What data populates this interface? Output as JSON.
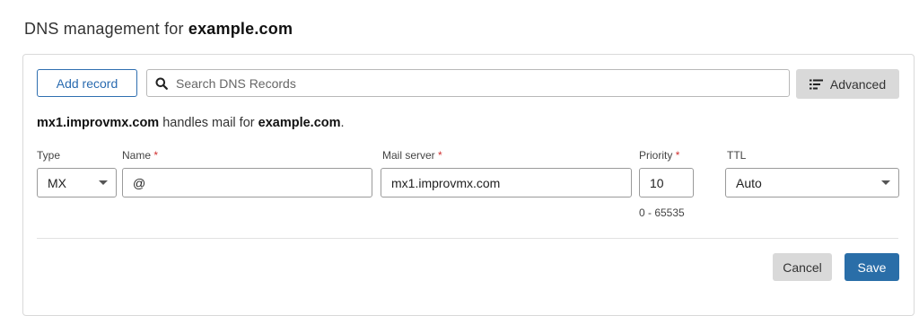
{
  "header": {
    "title_prefix": "DNS management for",
    "domain": "example.com"
  },
  "toolbar": {
    "add_record_label": "Add record",
    "search_placeholder": "Search DNS Records",
    "search_icon": "search-icon",
    "advanced_label": "Advanced",
    "advanced_icon": "filter-list-icon"
  },
  "mail_notice": {
    "server": "mx1.improvmx.com",
    "text": "handles mail for",
    "domain": "example.com",
    "suffix": "."
  },
  "form": {
    "type": {
      "label": "Type",
      "value": "MX"
    },
    "name": {
      "label": "Name",
      "required_mark": "*",
      "value": "@"
    },
    "mail_server": {
      "label": "Mail server",
      "required_mark": "*",
      "value": "mx1.improvmx.com"
    },
    "priority": {
      "label": "Priority",
      "required_mark": "*",
      "value": "10",
      "hint": "0 - 65535"
    },
    "ttl": {
      "label": "TTL",
      "value": "Auto"
    }
  },
  "actions": {
    "cancel_label": "Cancel",
    "save_label": "Save"
  },
  "colors": {
    "primary": "#2a6ea8",
    "required": "#d03030",
    "secondary_button": "#d9d9d9"
  }
}
